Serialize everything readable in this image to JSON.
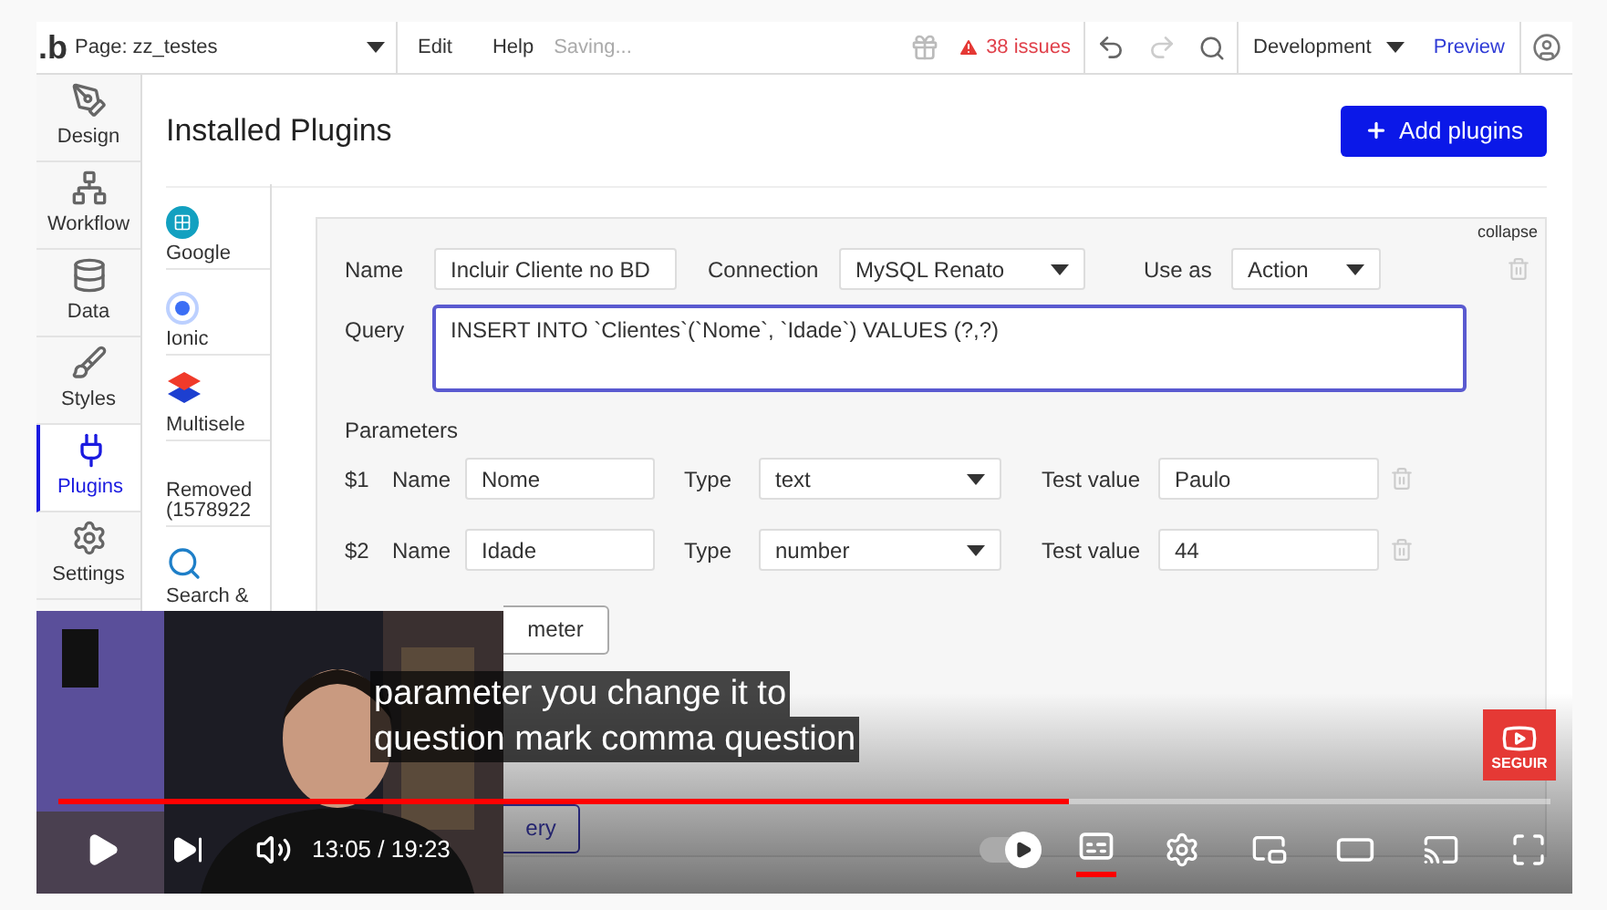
{
  "topbar": {
    "logo": ".b",
    "page_label": "Page: zz_testes",
    "menu": [
      "Edit",
      "Help"
    ],
    "status": "Saving...",
    "issues": "38 issues",
    "environment": "Development",
    "preview": "Preview"
  },
  "sidebar": [
    {
      "label": "Design",
      "kind": "design",
      "selected": false
    },
    {
      "label": "Workflow",
      "kind": "workflow",
      "selected": false
    },
    {
      "label": "Data",
      "kind": "data",
      "selected": false
    },
    {
      "label": "Styles",
      "kind": "styles",
      "selected": false
    },
    {
      "label": "Plugins",
      "kind": "plugins",
      "selected": true
    },
    {
      "label": "Settings",
      "kind": "settings",
      "selected": false
    }
  ],
  "heading": "Installed Plugins",
  "add_button": "Add plugins",
  "plugins": [
    {
      "label": "Google",
      "kind": "grid"
    },
    {
      "label": "Ionic",
      "kind": "ring"
    },
    {
      "label": "Multisele",
      "kind": "layers"
    },
    {
      "label": "Removed (1578922",
      "kind": "none"
    },
    {
      "label": "Search &",
      "kind": "search"
    }
  ],
  "call": {
    "collapse": "collapse",
    "name_label": "Name",
    "name_value": "Incluir Cliente no BD",
    "connection_label": "Connection",
    "connection_value": "MySQL Renato",
    "use_as_label": "Use as",
    "use_as_value": "Action",
    "query_label": "Query",
    "query_value": "INSERT INTO `Clientes`(`Nome`, `Idade`) VALUES (?,?)",
    "parameters_title": "Parameters",
    "parameters": [
      {
        "index": "$1",
        "name_label": "Name",
        "name": "Nome",
        "type_label": "Type",
        "type": "text",
        "test_label": "Test value",
        "test_value": "Paulo"
      },
      {
        "index": "$2",
        "name_label": "Name",
        "name": "Idade",
        "type_label": "Type",
        "type": "number",
        "test_label": "Test value",
        "test_value": "44"
      }
    ],
    "add_parameter": "meter",
    "test_query": "ery"
  },
  "player": {
    "captions": [
      "parameter you change it to",
      "question mark comma question"
    ],
    "time": "13:05 / 19:23",
    "progress": {
      "level": 0.677
    },
    "subscribe": "SEGUIR",
    "captions_on": true,
    "autoplay": true
  }
}
